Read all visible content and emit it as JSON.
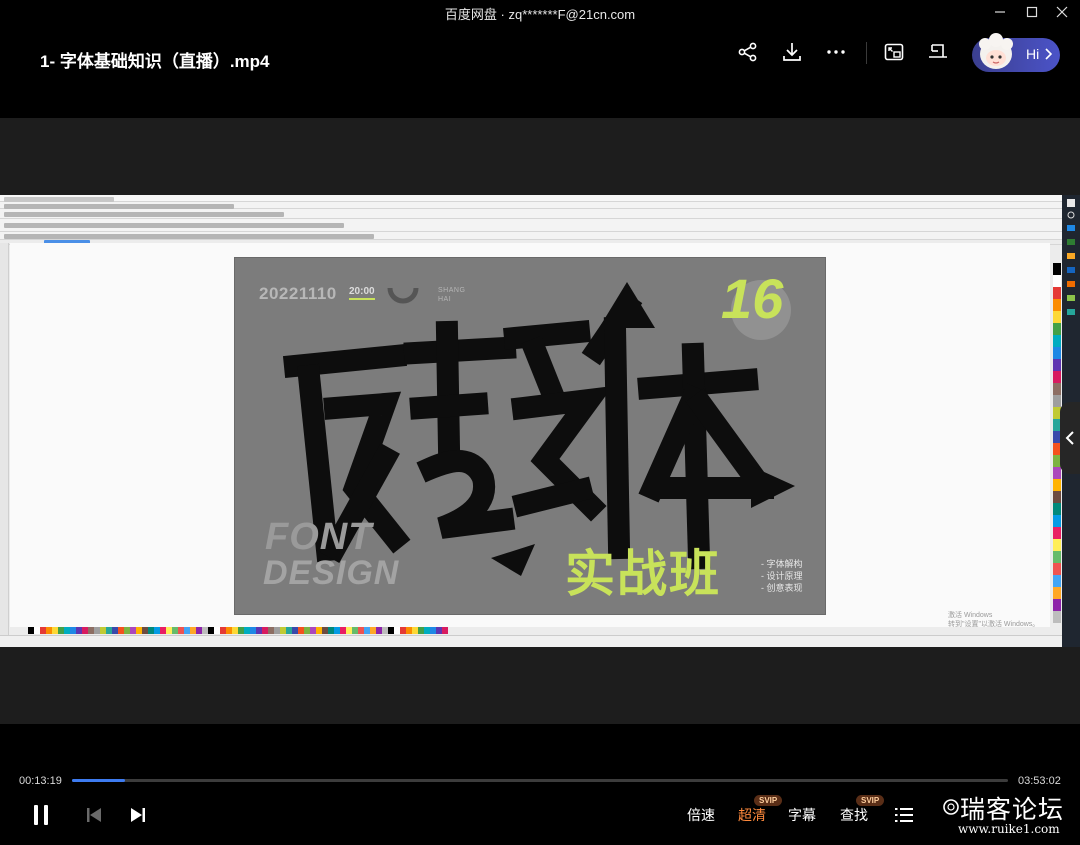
{
  "window": {
    "app_name": "百度网盘",
    "separator": "·",
    "account": "zq*******F@21cn.com"
  },
  "header": {
    "video_title": "1- 字体基础知识（直播）.mp4",
    "hi_label": "Hi"
  },
  "icons": {
    "share": "share-icon",
    "download": "download-icon",
    "more": "more-icon",
    "picture_in_picture": "picture-in-picture-icon",
    "mini_window": "mini-window-icon"
  },
  "poster": {
    "date": "20221110",
    "time": "20:00",
    "location_line1": "SHANG",
    "location_line2": "HAI",
    "number": "16",
    "font_word": "FONT",
    "design_word": "DESIGN",
    "camp_title": "实战班",
    "bullets": [
      "- 字体解构",
      "- 设计原理",
      "- 创意表现"
    ],
    "accent_color": "#c8e25a"
  },
  "frame": {
    "watermark_line1": "激活 Windows",
    "watermark_line2": "转到\"设置\"以激活 Windows。"
  },
  "player": {
    "current_time": "00:13:19",
    "total_time": "03:53:02",
    "progress": 0.057,
    "speed_label": "倍速",
    "quality_label": "超清",
    "quality_color": "#ff8a3d",
    "subtitle_label": "字幕",
    "search_label": "查找",
    "svip_badge": "SVIP",
    "accent_color": "#3d7bf0"
  },
  "brand": {
    "name": "瑞客论坛",
    "url": "www.ruike1.com"
  }
}
